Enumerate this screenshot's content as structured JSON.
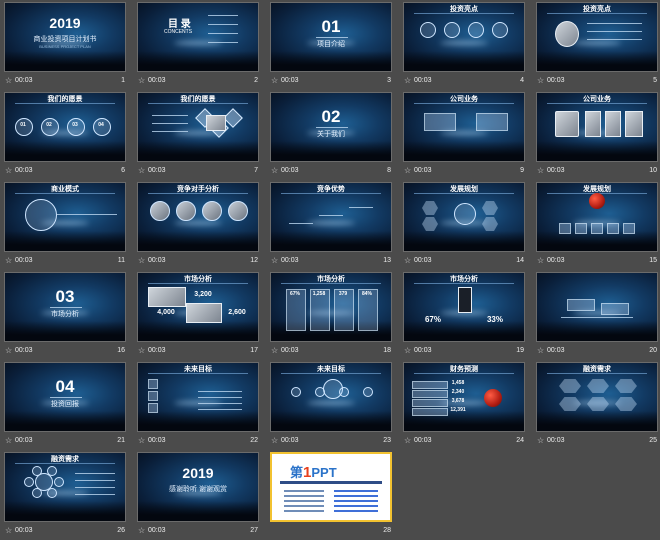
{
  "slides": [
    {
      "num": "1",
      "time": "00:03",
      "kind": "title",
      "title": "2019",
      "subtitle": "商业投资项目计划书",
      "tiny": "BUSINESS PROJECT PLAN"
    },
    {
      "num": "2",
      "time": "00:03",
      "kind": "toc",
      "title": "目 录",
      "subtitle": "CONCENTS"
    },
    {
      "num": "3",
      "time": "00:03",
      "kind": "section",
      "title": "01",
      "subtitle": "项目介绍"
    },
    {
      "num": "4",
      "time": "00:03",
      "kind": "circles",
      "header": "投资亮点"
    },
    {
      "num": "5",
      "time": "00:03",
      "kind": "photos",
      "header": "投资亮点"
    },
    {
      "num": "6",
      "time": "00:03",
      "kind": "medals",
      "header": "我们的愿景",
      "labels": [
        "01",
        "02",
        "03",
        "04"
      ]
    },
    {
      "num": "7",
      "time": "00:03",
      "kind": "diamonds",
      "header": "我们的愿景"
    },
    {
      "num": "8",
      "time": "00:03",
      "kind": "section",
      "title": "02",
      "subtitle": "关于我们"
    },
    {
      "num": "9",
      "time": "00:03",
      "kind": "boxes",
      "header": "公司业务"
    },
    {
      "num": "10",
      "time": "00:03",
      "kind": "photos",
      "header": "公司业务"
    },
    {
      "num": "11",
      "time": "00:03",
      "kind": "lamp",
      "header": "商业模式"
    },
    {
      "num": "12",
      "time": "00:03",
      "kind": "rings",
      "header": "竞争对手分析"
    },
    {
      "num": "13",
      "time": "00:03",
      "kind": "steps",
      "header": "竞争优势"
    },
    {
      "num": "14",
      "time": "00:03",
      "kind": "hexes",
      "header": "发展规划"
    },
    {
      "num": "15",
      "time": "00:03",
      "kind": "planet",
      "header": "发展规划"
    },
    {
      "num": "16",
      "time": "00:03",
      "kind": "section",
      "title": "03",
      "subtitle": "市场分析"
    },
    {
      "num": "17",
      "time": "00:03",
      "kind": "market",
      "header": "市场分析",
      "values": [
        "3,200",
        "4,000",
        "2,600"
      ]
    },
    {
      "num": "18",
      "time": "00:03",
      "kind": "percents",
      "header": "市场分析",
      "values": [
        "67%",
        "1,258",
        "379",
        "84%"
      ]
    },
    {
      "num": "19",
      "time": "00:03",
      "kind": "phone",
      "header": "市场分析",
      "values": [
        "67%",
        "33%"
      ]
    },
    {
      "num": "20",
      "time": "00:03",
      "kind": "scale",
      "header": ""
    },
    {
      "num": "21",
      "time": "00:03",
      "kind": "section",
      "title": "04",
      "subtitle": "投资回报"
    },
    {
      "num": "22",
      "time": "00:03",
      "kind": "flow",
      "header": "未来目标"
    },
    {
      "num": "23",
      "time": "00:03",
      "kind": "hub",
      "header": "未来目标"
    },
    {
      "num": "24",
      "time": "00:03",
      "kind": "finance",
      "header": "财务预测",
      "values": [
        "1,458",
        "2,340",
        "3,678",
        "12,391"
      ]
    },
    {
      "num": "25",
      "time": "00:03",
      "kind": "hexgrid",
      "header": "融资需求"
    },
    {
      "num": "26",
      "time": "00:03",
      "kind": "flower",
      "header": "融资需求"
    },
    {
      "num": "27",
      "time": "00:03",
      "kind": "end",
      "title": "2019",
      "subtitle": "感谢聆听 谢谢观赏"
    },
    {
      "num": "28",
      "time": "",
      "kind": "final",
      "logo_a": "第",
      "logo_one": "1",
      "logo_b": "PPT"
    }
  ],
  "selected_slide": "28",
  "colors": {
    "background": "#4b4b4b",
    "selection": "#f2c230",
    "slide_bg": "#0a1f3a",
    "accent_red": "#c0271a"
  },
  "icons": {
    "transition": "star-icon"
  }
}
